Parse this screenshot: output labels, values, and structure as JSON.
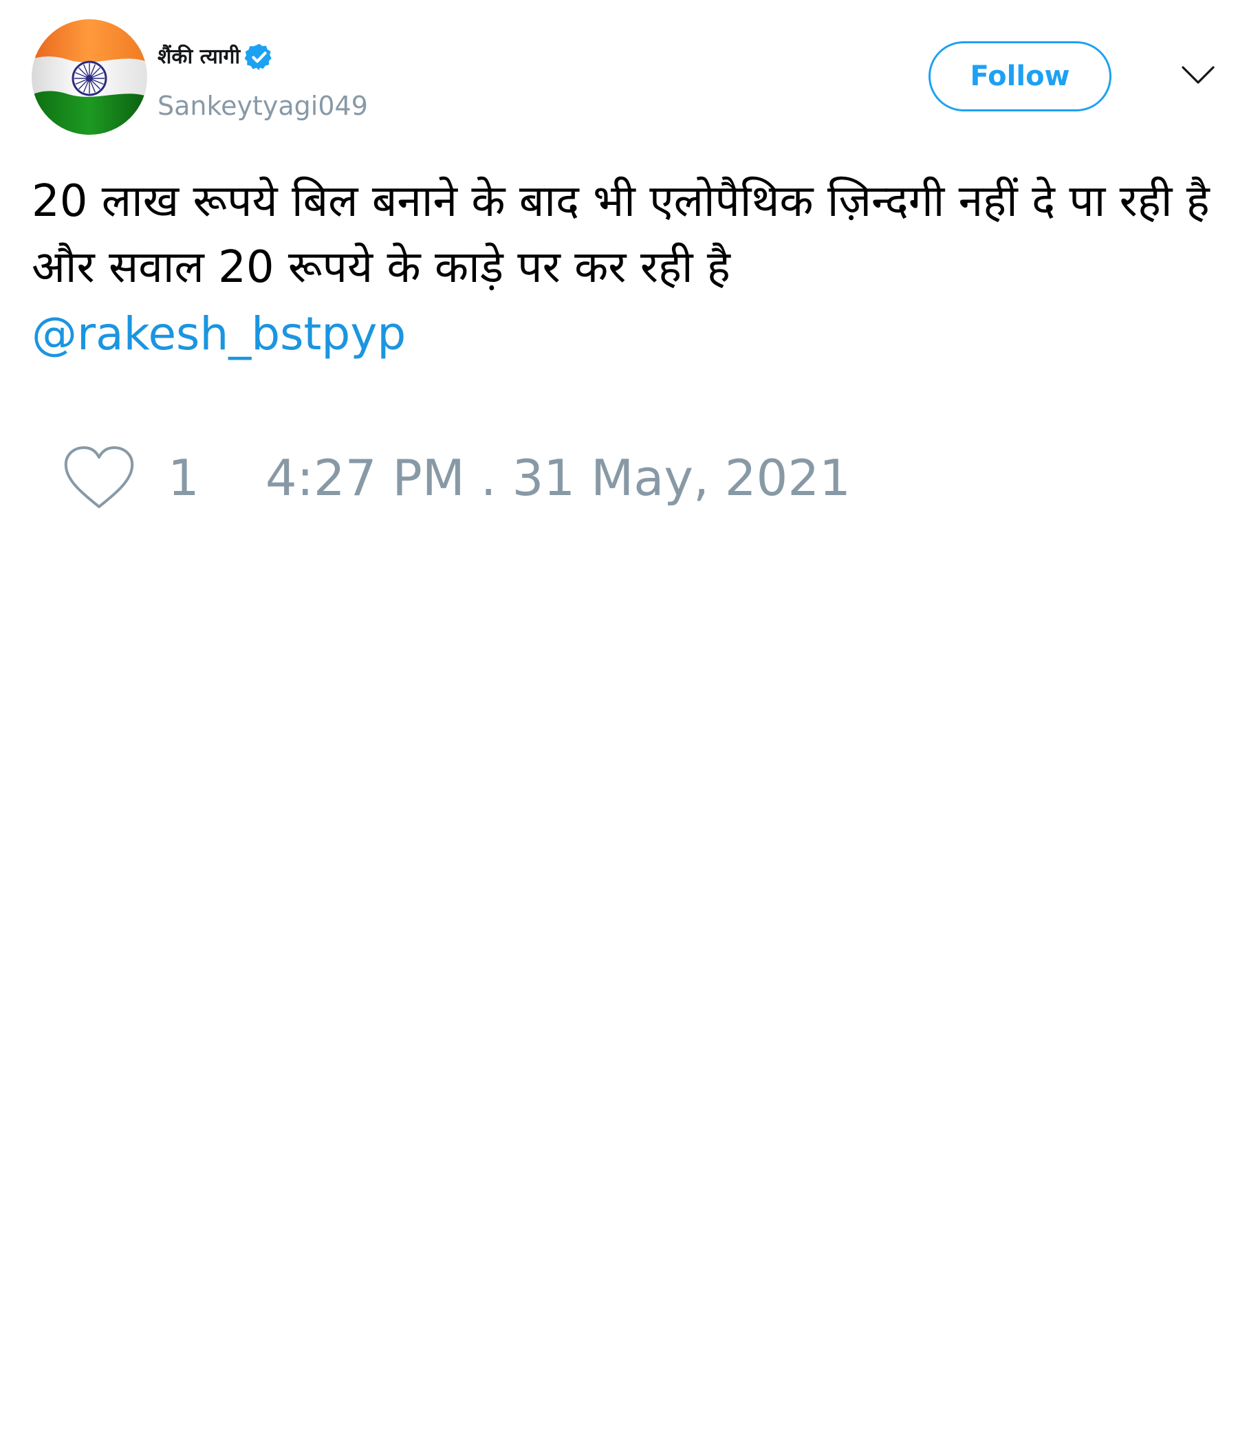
{
  "author": {
    "display_name": "शैंकी त्यागी",
    "username": "Sankeytyagi049",
    "verified": true
  },
  "follow_button": {
    "label": "Follow"
  },
  "tweet": {
    "text": "20 लाख रूपये बिल बनाने के बाद भी एलोपैथिक ज़िन्दगी नहीं दे पा रही है और सवाल 20 रूपये के काड़े पर कर रही है",
    "mention": "@rakesh_bstpyp"
  },
  "stats": {
    "like_count": "1",
    "timestamp": "4:27 PM . 31 May, 2021"
  },
  "icons": {
    "avatar": "india-flag-icon",
    "verified": "verified-badge-icon",
    "caret": "chevron-down-icon",
    "like": "heart-icon"
  },
  "colors": {
    "accent": "#1da1f2",
    "mention": "#1b95e0",
    "muted": "#8899a6",
    "flag_saffron": "#ff9933",
    "flag_green": "#138808",
    "chakra": "#000080"
  }
}
